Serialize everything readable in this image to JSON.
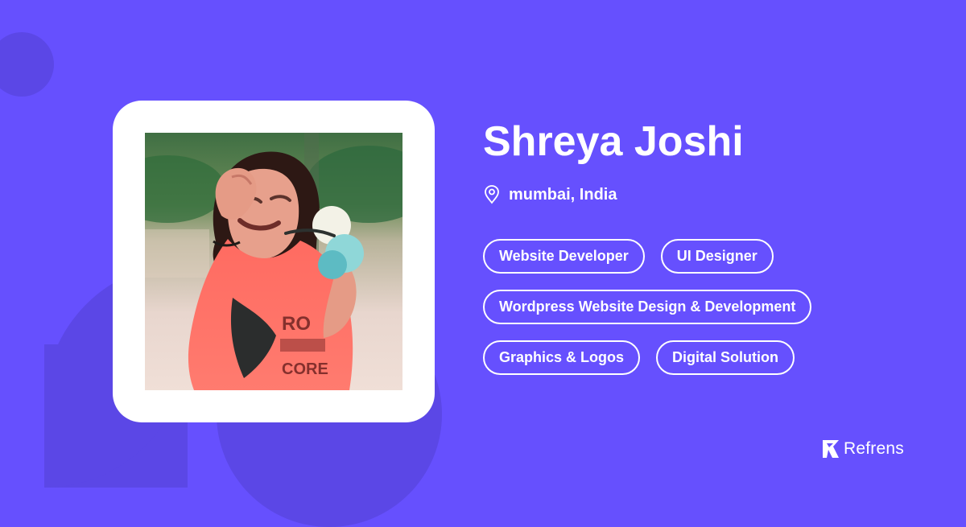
{
  "profile": {
    "name": "Shreya Joshi",
    "location": "mumbai, India",
    "photo_icon": "profile-photo"
  },
  "skills": [
    {
      "label": "Website Developer"
    },
    {
      "label": "UI Designer"
    },
    {
      "label": "Wordpress Website Design & Development"
    },
    {
      "label": "Graphics & Logos"
    },
    {
      "label": "Digital Solution"
    }
  ],
  "brand": {
    "name": "Refrens",
    "icon": "refrens-logo-icon"
  },
  "colors": {
    "background": "#6650fe",
    "shape": "#5b47e6",
    "card": "#ffffff",
    "text": "#ffffff"
  }
}
